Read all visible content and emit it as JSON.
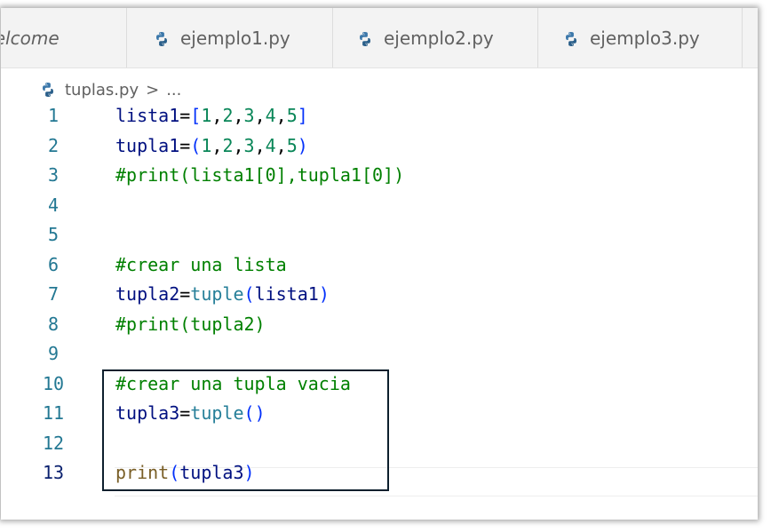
{
  "tabs": [
    {
      "label": "/elcome",
      "icon": null
    },
    {
      "label": "ejemplo1.py",
      "icon": "python-icon"
    },
    {
      "label": "ejemplo2.py",
      "icon": "python-icon"
    },
    {
      "label": "ejemplo3.py",
      "icon": "python-icon"
    }
  ],
  "breadcrumb": {
    "file": "tuplas.py",
    "separator": ">",
    "more": "...",
    "icon": "python-icon"
  },
  "editor": {
    "active_line": 13,
    "lines": [
      {
        "number": "1",
        "tokens": [
          {
            "t": "lista1",
            "c": "var"
          },
          {
            "t": "=",
            "c": "op"
          },
          {
            "t": "[",
            "c": "br"
          },
          {
            "t": "1",
            "c": "num"
          },
          {
            "t": ",",
            "c": "punc"
          },
          {
            "t": "2",
            "c": "num"
          },
          {
            "t": ",",
            "c": "punc"
          },
          {
            "t": "3",
            "c": "num"
          },
          {
            "t": ",",
            "c": "punc"
          },
          {
            "t": "4",
            "c": "num"
          },
          {
            "t": ",",
            "c": "punc"
          },
          {
            "t": "5",
            "c": "num"
          },
          {
            "t": "]",
            "c": "br"
          }
        ]
      },
      {
        "number": "2",
        "tokens": [
          {
            "t": "tupla1",
            "c": "var"
          },
          {
            "t": "=",
            "c": "op"
          },
          {
            "t": "(",
            "c": "br"
          },
          {
            "t": "1",
            "c": "num"
          },
          {
            "t": ",",
            "c": "punc"
          },
          {
            "t": "2",
            "c": "num"
          },
          {
            "t": ",",
            "c": "punc"
          },
          {
            "t": "3",
            "c": "num"
          },
          {
            "t": ",",
            "c": "punc"
          },
          {
            "t": "4",
            "c": "num"
          },
          {
            "t": ",",
            "c": "punc"
          },
          {
            "t": "5",
            "c": "num"
          },
          {
            "t": ")",
            "c": "br"
          }
        ]
      },
      {
        "number": "3",
        "tokens": [
          {
            "t": "#print(lista1[0],tupla1[0])",
            "c": "cmt"
          }
        ]
      },
      {
        "number": "4",
        "tokens": []
      },
      {
        "number": "5",
        "tokens": []
      },
      {
        "number": "6",
        "tokens": [
          {
            "t": "#crear una lista",
            "c": "cmt"
          }
        ]
      },
      {
        "number": "7",
        "tokens": [
          {
            "t": "tupla2",
            "c": "var"
          },
          {
            "t": "=",
            "c": "op"
          },
          {
            "t": "tuple",
            "c": "fn"
          },
          {
            "t": "(",
            "c": "br"
          },
          {
            "t": "lista1",
            "c": "var"
          },
          {
            "t": ")",
            "c": "br"
          }
        ]
      },
      {
        "number": "8",
        "tokens": [
          {
            "t": "#print(tupla2)",
            "c": "cmt"
          }
        ]
      },
      {
        "number": "9",
        "tokens": []
      },
      {
        "number": "10",
        "tokens": [
          {
            "t": "#crear una tupla vacia",
            "c": "cmt"
          }
        ]
      },
      {
        "number": "11",
        "tokens": [
          {
            "t": "tupla3",
            "c": "var"
          },
          {
            "t": "=",
            "c": "op"
          },
          {
            "t": "tuple",
            "c": "fn"
          },
          {
            "t": "(",
            "c": "br"
          },
          {
            "t": ")",
            "c": "br"
          }
        ]
      },
      {
        "number": "12",
        "tokens": []
      },
      {
        "number": "13",
        "tokens": [
          {
            "t": "print",
            "c": "print"
          },
          {
            "t": "(",
            "c": "br"
          },
          {
            "t": "tupla3",
            "c": "var"
          },
          {
            "t": ")",
            "c": "br"
          }
        ]
      }
    ]
  },
  "colors": {
    "line_number": "#237893",
    "line_number_active": "#0b216f",
    "variable": "#001080",
    "number": "#098658",
    "comment": "#008000",
    "builtin": "#267f99",
    "function": "#795e26",
    "bracket": "#0431fa",
    "python_icon_blue": "#3c78aa",
    "python_icon_dark": "#2a5f8a"
  }
}
